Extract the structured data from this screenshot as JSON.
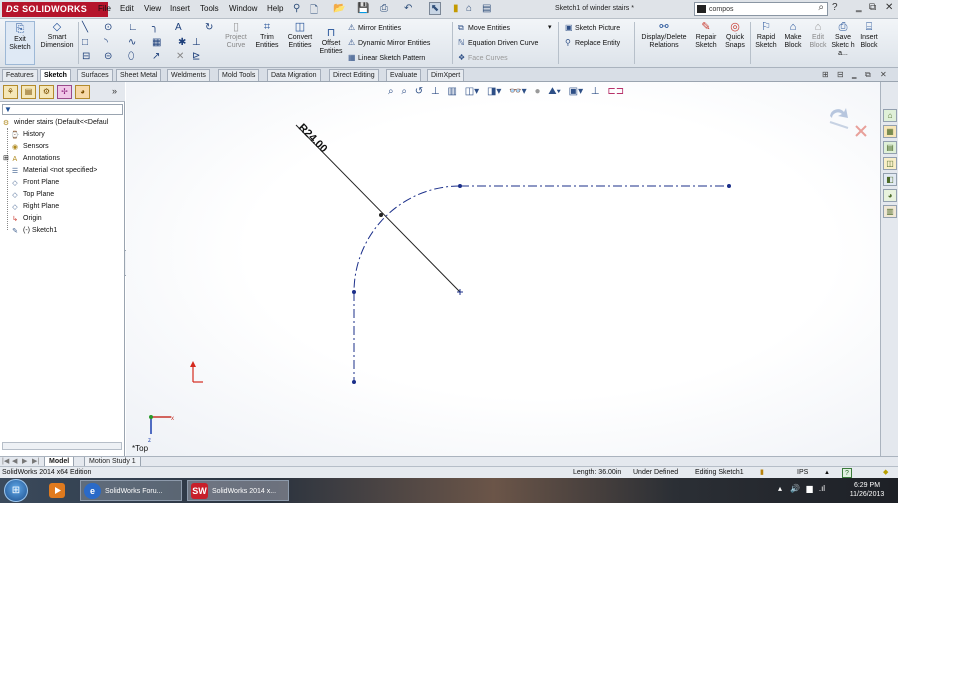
{
  "titlebar": {
    "logo_text": "SOLIDWORKS",
    "logo_prefix": "DS",
    "menus": [
      "File",
      "Edit",
      "View",
      "Insert",
      "Tools",
      "Window",
      "Help"
    ],
    "document_title": "Sketch1 of winder stairs *",
    "search_value": "compos",
    "help_label": "?"
  },
  "commandmanager": {
    "exit_sketch": "Exit Sketch",
    "smart_dimension": "Smart Dimension",
    "project_curve": "Project Curve",
    "trim_entities": "Trim Entities",
    "convert_entities": "Convert Entities",
    "offset_entities": "Offset Entities",
    "mirror_entities": "Mirror Entities",
    "dynamic_mirror_entities": "Dynamic Mirror Entities",
    "linear_sketch_pattern": "Linear Sketch Pattern",
    "move_entities": "Move Entities",
    "equation_driven_curve": "Equation Driven Curve",
    "face_curves": "Face Curves",
    "sketch_picture": "Sketch Picture",
    "replace_entity": "Replace Entity",
    "display_delete_relations": "Display/Delete Relations",
    "repair_sketch": "Repair Sketch",
    "quick_snaps": "Quick Snaps",
    "rapid_sketch": "Rapid Sketch",
    "make_block": "Make Block",
    "edit_block": "Edit Block",
    "save_sketch": "Save Sketc h a...",
    "insert_block": "Insert Block"
  },
  "tabs": [
    "Features",
    "Sketch",
    "Surfaces",
    "Sheet Metal",
    "Weldments",
    "Mold Tools",
    "Data Migration",
    "Direct Editing",
    "Evaluate",
    "DimXpert"
  ],
  "active_tab": "Sketch",
  "tree": {
    "root": "winder stairs  (Default<<Defaul",
    "items": [
      "History",
      "Sensors",
      "Annotations",
      "Material <not specified>",
      "Front Plane",
      "Top Plane",
      "Right Plane",
      "Origin",
      "(-) Sketch1"
    ]
  },
  "graphics": {
    "dimension_label": "R24.00",
    "view_label": "*Top"
  },
  "bottom_tabs": [
    "Model",
    "Motion Study 1"
  ],
  "status": {
    "edition": "SolidWorks 2014 x64 Edition",
    "length": "Length: 36.00in",
    "state": "Under Defined",
    "mode": "Editing Sketch1",
    "units": "IPS",
    "units_arrow": "▲",
    "help": "?"
  },
  "taskbar": {
    "app1": "SolidWorks Foru...",
    "app2": "SolidWorks 2014 x...",
    "time": "6:29 PM",
    "date": "11/26/2013"
  }
}
